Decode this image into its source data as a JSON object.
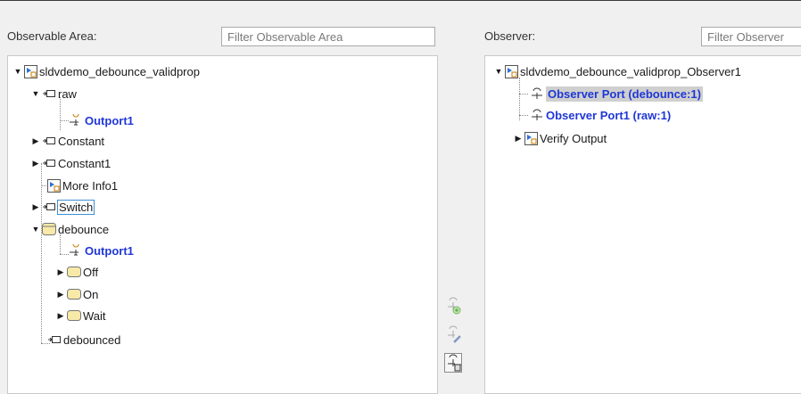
{
  "left": {
    "label": "Observable Area:",
    "filter_placeholder": "Filter Observable Area",
    "tree": {
      "root": "sldvdemo_debounce_validprop",
      "raw": "raw",
      "raw_outport": "Outport1",
      "constant": "Constant",
      "constant1": "Constant1",
      "more_info": "More Info1",
      "switch": "Switch",
      "debounce": "debounce",
      "debounce_outport": "Outport1",
      "off": "Off",
      "on": "On",
      "wait": "Wait",
      "debounced": "debounced"
    }
  },
  "right": {
    "label": "Observer:",
    "filter_placeholder": "Filter Observer",
    "tree": {
      "root": "sldvdemo_debounce_validprop_Observer1",
      "port_debounce": "Observer Port (debounce:1)",
      "port_raw": "Observer Port1 (raw:1)",
      "verify_output": "Verify Output"
    }
  },
  "colors": {
    "port_text": "#1f37d6",
    "selection": "#cfcfcf",
    "focus_border": "#3d8fd6"
  }
}
